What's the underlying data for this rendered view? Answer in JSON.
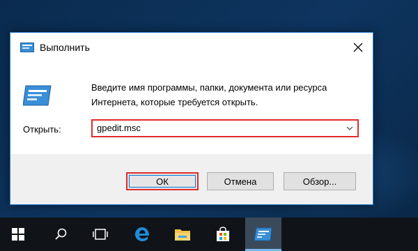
{
  "dialog": {
    "title": "Выполнить",
    "description": "Введите имя программы, папки, документа или ресурса Интернета, которые требуется открыть.",
    "open_label": "Открыть:",
    "open_value": "gpedit.msc",
    "buttons": {
      "ok": "ОК",
      "cancel": "Отмена",
      "browse": "Обзор..."
    }
  },
  "taskbar": {
    "items": [
      {
        "icon": "windows-start-icon"
      },
      {
        "icon": "search-icon"
      },
      {
        "icon": "task-view-icon"
      },
      {
        "icon": "edge-browser-icon"
      },
      {
        "icon": "file-explorer-icon"
      },
      {
        "icon": "store-icon"
      },
      {
        "icon": "run-dialog-icon",
        "active": true
      }
    ]
  },
  "colors": {
    "highlight": "#e02c2c",
    "accent": "#0078d7",
    "taskbar": "#101418"
  }
}
